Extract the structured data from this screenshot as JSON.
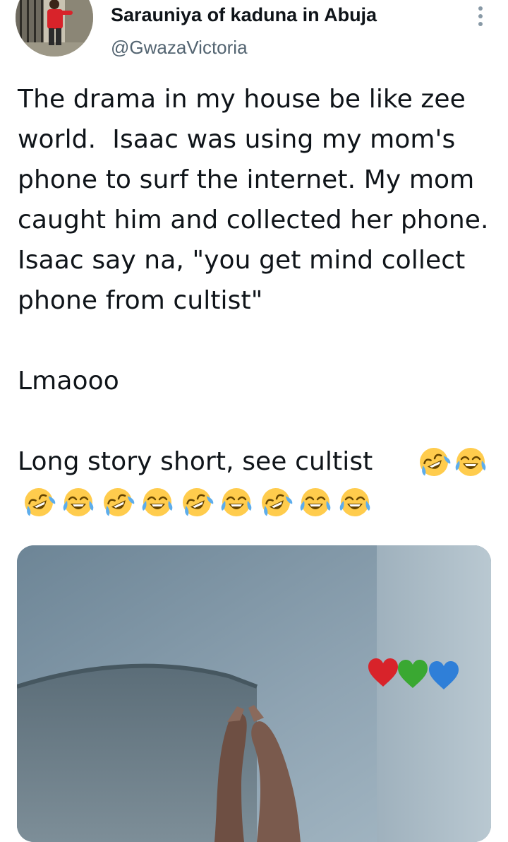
{
  "user": {
    "display_name": "Sarauniya of kaduna in Abuja",
    "handle": "@GwazaVictoria",
    "avatar_icon": "profile-photo"
  },
  "menu": {
    "icon": "more-vertical-icon"
  },
  "tweet": {
    "paragraph_1": "The drama in my house be like zee world.  Isaac was using my mom's phone to surf the internet. My mom caught him and collected her phone. Isaac say na, \"you get mind collect phone from cultist\"",
    "paragraph_2": "Lmaooo",
    "paragraph_3": "Long story short, see cultist",
    "emoji_sequence": [
      "rofl",
      "joy",
      "rofl",
      "joy",
      "rofl",
      "joy",
      "rofl",
      "joy",
      "rofl",
      "joy",
      "joy"
    ]
  },
  "media": {
    "overlay_emojis": [
      "red-heart",
      "green-heart",
      "blue-heart"
    ]
  },
  "colors": {
    "text": "#0f1419",
    "secondary_text": "#536471",
    "emoji_yellow": "#ffcc4d",
    "emoji_tear": "#5dadec"
  }
}
